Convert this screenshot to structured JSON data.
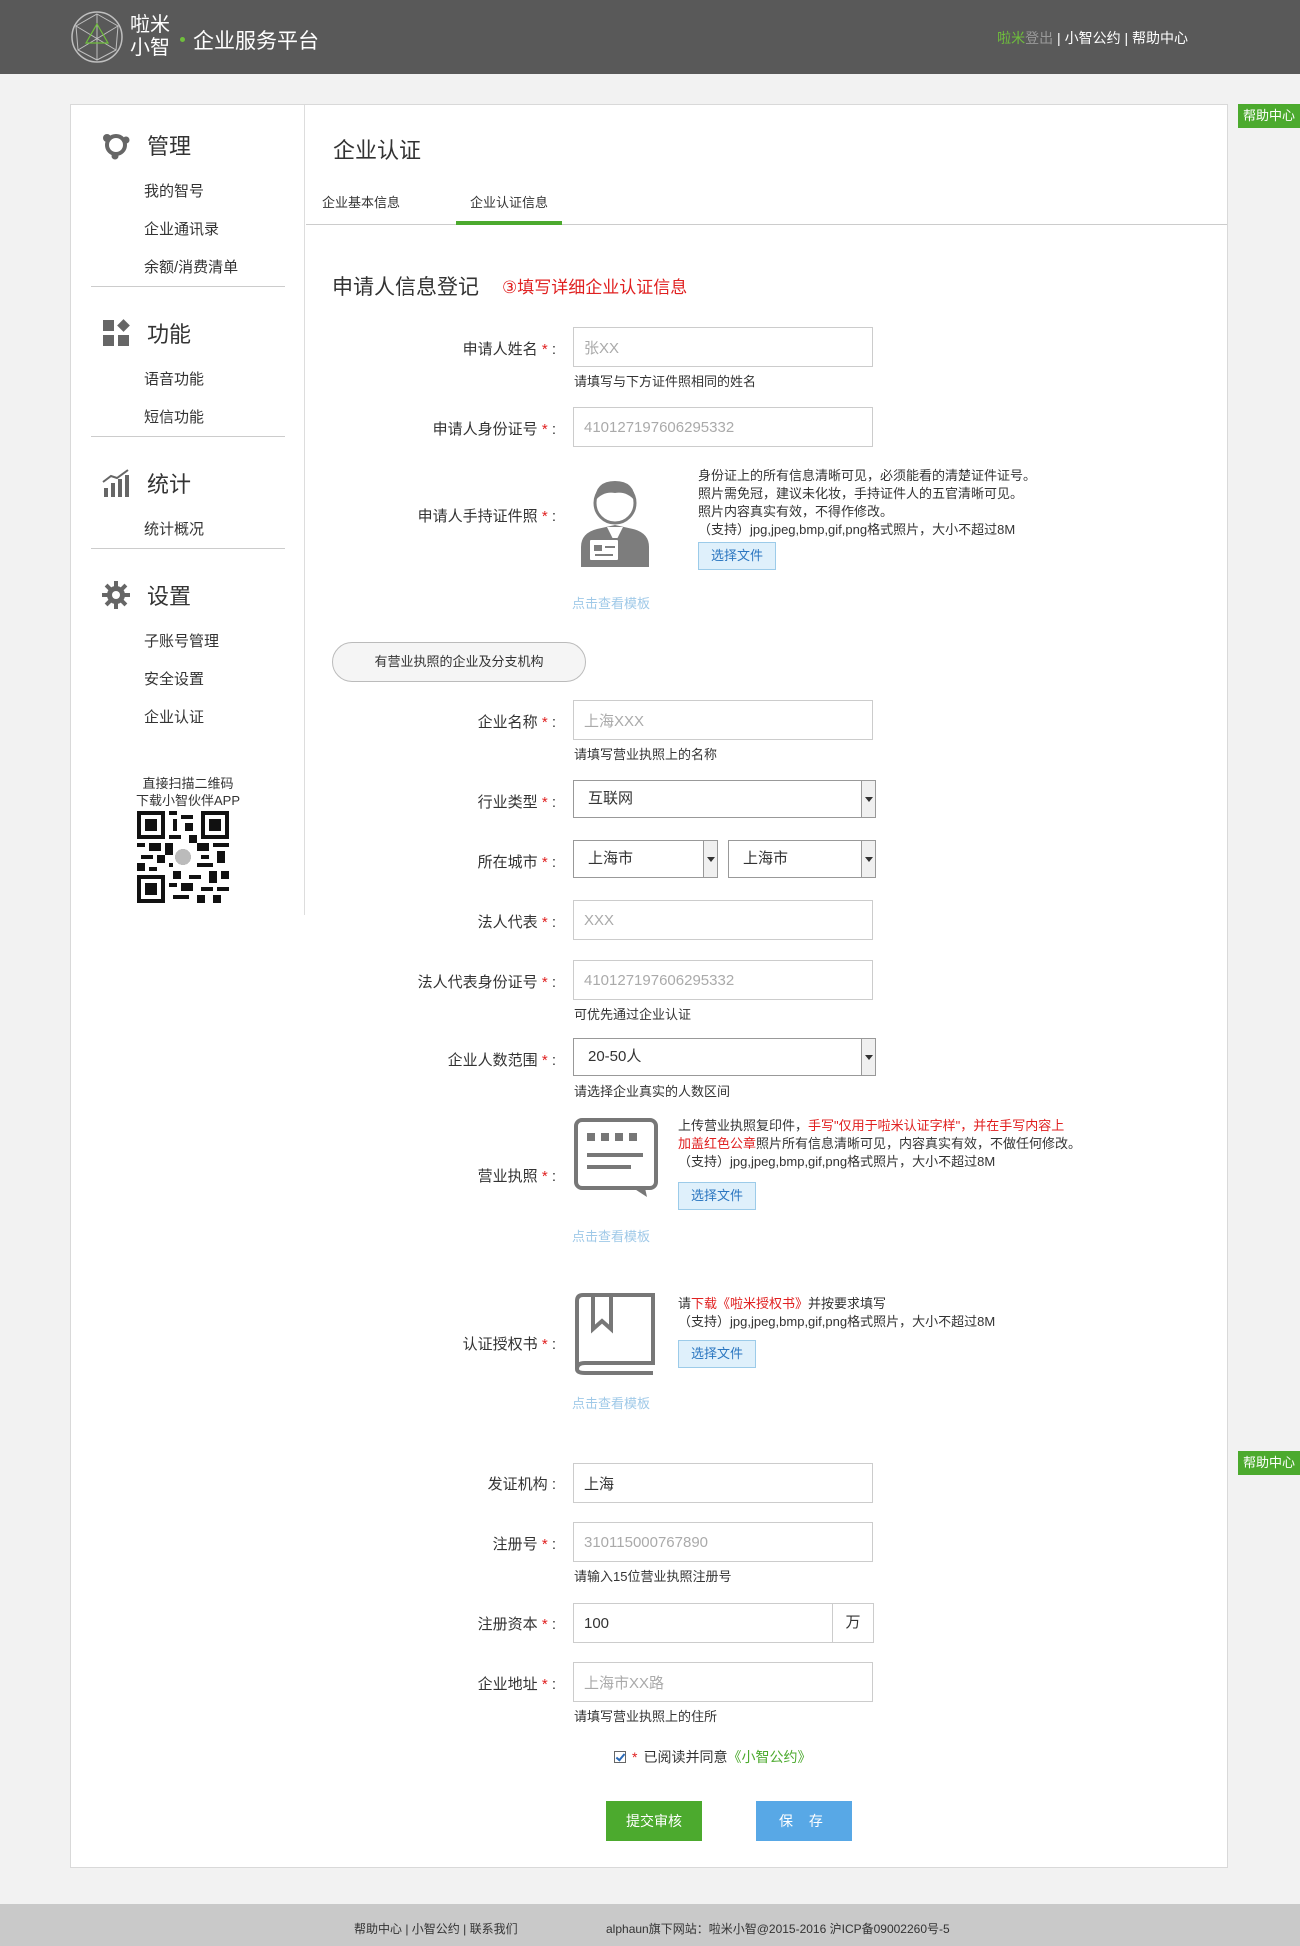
{
  "header": {
    "logo_text_1": "啦米",
    "logo_text_2": "小智",
    "platform_title": "企业服务平台",
    "link_lami": "啦米",
    "link_logout": "登出",
    "sep": "|",
    "link_agreement": "小智公约",
    "link_help": "帮助中心"
  },
  "help_float": "帮助中心",
  "sidebar": {
    "groups": [
      {
        "title": "管理",
        "icon": "management-icon",
        "items": [
          "我的智号",
          "企业通讯录",
          "余额/消费清单"
        ]
      },
      {
        "title": "功能",
        "icon": "functions-icon",
        "items": [
          "语音功能",
          "短信功能"
        ]
      },
      {
        "title": "统计",
        "icon": "statistics-icon",
        "items": [
          "统计概况"
        ]
      },
      {
        "title": "设置",
        "icon": "gear-icon",
        "items": [
          "子账号管理",
          "安全设置",
          "企业认证"
        ]
      }
    ],
    "qr_caption_1": "直接扫描二维码",
    "qr_caption_2": "下载小智伙伴APP"
  },
  "page": {
    "title": "企业认证",
    "tabs": [
      "企业基本信息",
      "企业认证信息"
    ],
    "active_tab": 1,
    "section_title": "申请人信息登记",
    "section_note": "③填写详细企业认证信息"
  },
  "form": {
    "required_mark": "*",
    "applicant_name": {
      "label": "申请人姓名",
      "value": "张XX",
      "hint": "请填写与下方证件照相同的姓名"
    },
    "applicant_id": {
      "label": "申请人身份证号",
      "value": "410127197606295332"
    },
    "applicant_photo": {
      "label": "申请人手持证件照",
      "desc": [
        "身份证上的所有信息清晰可见，必须能看的清楚证件证号。",
        "照片需免冠，建议未化妆，手持证件人的五官清晰可见。",
        "照片内容真实有效，不得作修改。",
        "（支持）jpg,jpeg,bmp,gif,png格式照片，大小不超过8M"
      ],
      "button": "选择文件",
      "template_link": "点击查看模板"
    },
    "org_type_pill": "有营业执照的企业及分支机构",
    "company_name": {
      "label": "企业名称",
      "value": "上海XXX",
      "hint": "请填写营业执照上的名称"
    },
    "industry": {
      "label": "行业类型",
      "value": "互联网"
    },
    "city": {
      "label": "所在城市",
      "province": "上海市",
      "city": "上海市"
    },
    "legal_rep": {
      "label": "法人代表",
      "value": "XXX"
    },
    "legal_rep_id": {
      "label": "法人代表身份证号",
      "value": "410127197606295332",
      "hint": "可优先通过企业认证"
    },
    "headcount": {
      "label": "企业人数范围",
      "value": "20-50人",
      "hint": "请选择企业真实的人数区间"
    },
    "business_license": {
      "label": "营业执照",
      "desc_1a": "上传营业执照复印件，",
      "desc_1b": "手写\"仅用于啦米认证字样\"，并在手写内容上",
      "desc_2a": "加盖红色公章",
      "desc_2b": "照片所有信息清晰可见，内容真实有效，不做任何修改。",
      "desc_3": "（支持）jpg,jpeg,bmp,gif,png格式照片，大小不超过8M",
      "button": "选择文件",
      "template_link": "点击查看模板"
    },
    "authorization": {
      "label": "认证授权书",
      "desc_1a": "请",
      "desc_1b": "下载《啦米授权书》",
      "desc_1c": "并按要求填写",
      "desc_2": "（支持）jpg,jpeg,bmp,gif,png格式照片，大小不超过8M",
      "button": "选择文件",
      "template_link": "点击查看模板"
    },
    "issuer": {
      "label": "发证机构",
      "value": "上海"
    },
    "reg_number": {
      "label": "注册号",
      "value": "310115000767890",
      "hint": "请输入15位营业执照注册号"
    },
    "reg_capital": {
      "label": "注册资本",
      "value": "100",
      "unit": "万"
    },
    "address": {
      "label": "企业地址",
      "value": "上海市XX路",
      "hint": "请填写营业执照上的住所"
    },
    "agree_text": "已阅读并同意",
    "agree_link": "《小智公约》",
    "submit_button": "提交审核",
    "save_button": "保 存"
  },
  "footer": {
    "links": "帮助中心  |  小智公约  |  联系我们",
    "copyright": "alphaun旗下网站：啦米小智@2015-2016 沪ICP备09002260号-5"
  },
  "colors": {
    "accent_green": "#4caa2e",
    "header_bg": "#595959",
    "red_note": "#e02020",
    "blue_button": "#58a8e6"
  }
}
